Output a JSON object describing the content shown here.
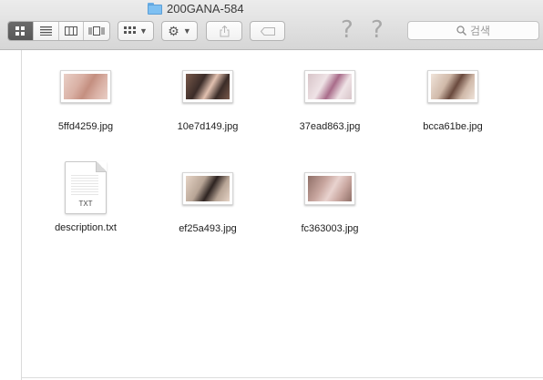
{
  "window": {
    "title": "200GANA-584"
  },
  "toolbar": {
    "view_modes": [
      "icon-view",
      "list-view",
      "column-view",
      "cover-flow-view"
    ],
    "arrange_icon": "grid-arrange-icon",
    "action_icon": "gear-icon",
    "share_icon": "share-icon",
    "tag_icon": "tag-icon",
    "help_icon": "question-icon",
    "search_placeholder": "검색"
  },
  "files": [
    {
      "name": "5ffd4259.jpg",
      "kind": "image",
      "palette": [
        "#d9b0a4",
        "#c48f80",
        "#e9cfc6"
      ]
    },
    {
      "name": "10e7d149.jpg",
      "kind": "image",
      "palette": [
        "#3b2c28",
        "#e2c1b0",
        "#7a5a4c"
      ]
    },
    {
      "name": "37ead863.jpg",
      "kind": "image",
      "palette": [
        "#efe3e6",
        "#a96c8a",
        "#d7c4c8"
      ]
    },
    {
      "name": "bcca61be.jpg",
      "kind": "image",
      "palette": [
        "#d0b9a9",
        "#6a4a3e",
        "#f0e4da"
      ]
    },
    {
      "name": "description.txt",
      "kind": "text",
      "ext_label": "TXT"
    },
    {
      "name": "ef25a493.jpg",
      "kind": "image",
      "palette": [
        "#b8a596",
        "#2e2421",
        "#e6d4c6"
      ]
    },
    {
      "name": "fc363003.jpg",
      "kind": "image",
      "palette": [
        "#c9a7a0",
        "#e9d3cf",
        "#8f6f67"
      ]
    }
  ]
}
